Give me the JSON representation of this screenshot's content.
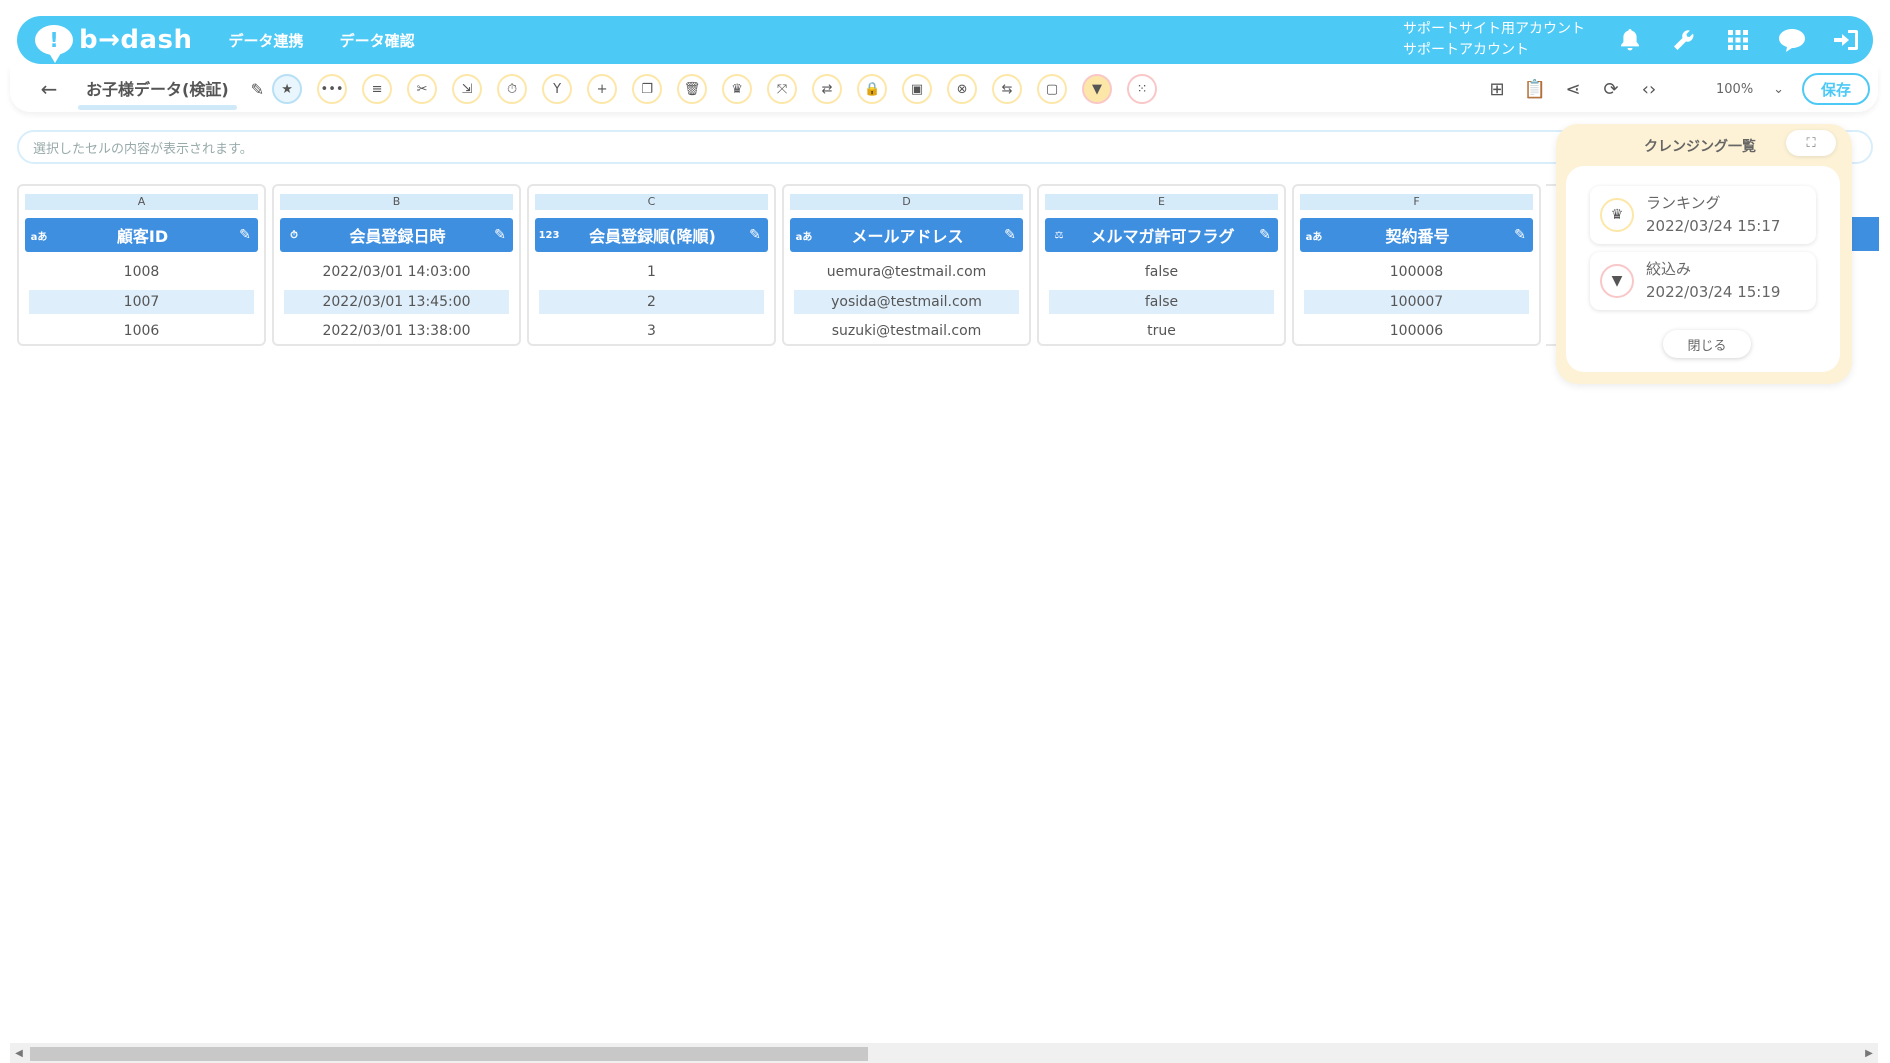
{
  "header": {
    "brand": "b→dash",
    "nav": [
      "データ連携",
      "データ確認"
    ],
    "account_line1": "サポートサイト用アカウント",
    "account_line2": "サポートアカウント",
    "icons": [
      "bell-icon",
      "wrench-icon",
      "grid-icon",
      "chat-icon",
      "logout-icon"
    ]
  },
  "toolbar": {
    "back_icon": "arrow-left-icon",
    "dataset_name": "お子様データ(検証)",
    "tools": [
      "star-icon",
      "dots-icon",
      "lines-icon",
      "scissors-icon",
      "compress-icon",
      "timer-icon",
      "merge-icon",
      "plus-icon",
      "copy-icon",
      "trash-icon",
      "crown-icon",
      "expand-icon",
      "repeat-icon",
      "lock-icon",
      "box-icon",
      "close-circle-icon",
      "swap-icon",
      "frame-icon",
      "filter-icon",
      "grid-dots-icon"
    ],
    "right_icons": [
      "flow-icon",
      "clipboard-icon",
      "share-icon",
      "refresh-icon",
      "code-icon"
    ],
    "zoom": "100%",
    "save_label": "保存"
  },
  "cellbar": {
    "placeholder": "選択したセルの内容が表示されます。"
  },
  "columns": [
    {
      "letter": "A",
      "type": "aあ",
      "title": "顧客ID",
      "cells": [
        "1008",
        "1007",
        "1006"
      ]
    },
    {
      "letter": "B",
      "type": "⏱",
      "title": "会員登録日時",
      "cells": [
        "2022/03/01 14:03:00",
        "2022/03/01 13:45:00",
        "2022/03/01 13:38:00"
      ]
    },
    {
      "letter": "C",
      "type": "123",
      "title": "会員登録順(降順)",
      "cells": [
        "1",
        "2",
        "3"
      ]
    },
    {
      "letter": "D",
      "type": "aあ",
      "title": "メールアドレス",
      "cells": [
        "uemura@testmail.com",
        "yosida@testmail.com",
        "suzuki@testmail.com"
      ]
    },
    {
      "letter": "E",
      "type": "⚖",
      "title": "メルマガ許可フラグ",
      "cells": [
        "false",
        "false",
        "true"
      ]
    },
    {
      "letter": "F",
      "type": "aあ",
      "title": "契約番号",
      "cells": [
        "100008",
        "100007",
        "100006"
      ]
    }
  ],
  "panel": {
    "title": "クレンジング一覧",
    "entries": [
      {
        "icon": "crown-icon",
        "name": "ランキング",
        "time": "2022/03/24 15:17"
      },
      {
        "icon": "filter-icon",
        "name": "絞込み",
        "time": "2022/03/24 15:19"
      }
    ],
    "close_label": "閉じる"
  }
}
